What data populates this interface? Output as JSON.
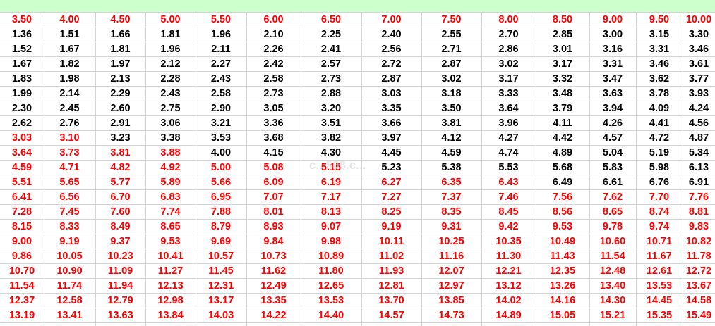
{
  "highlight_color": "#ff0000",
  "normal_color": "#000000",
  "watermark": "c...588.c...",
  "header": [
    "3.50",
    "4.00",
    "4.50",
    "5.00",
    "5.50",
    "6.00",
    "6.50",
    "7.00",
    "7.50",
    "8.00",
    "8.50",
    "9.00",
    "9.50",
    "10.00"
  ],
  "rows": [
    {
      "values": [
        "1.36",
        "1.51",
        "1.66",
        "1.81",
        "1.96",
        "2.10",
        "2.25",
        "2.40",
        "2.55",
        "2.70",
        "2.85",
        "3.00",
        "3.15",
        "3.30"
      ],
      "red": []
    },
    {
      "values": [
        "1.52",
        "1.67",
        "1.81",
        "1.96",
        "2.11",
        "2.26",
        "2.41",
        "2.56",
        "2.71",
        "2.86",
        "3.01",
        "3.16",
        "3.31",
        "3.46"
      ],
      "red": []
    },
    {
      "values": [
        "1.67",
        "1.82",
        "1.97",
        "2.12",
        "2.27",
        "2.42",
        "2.57",
        "2.72",
        "2.87",
        "3.02",
        "3.17",
        "3.31",
        "3.46",
        "3.61"
      ],
      "red": []
    },
    {
      "values": [
        "1.83",
        "1.98",
        "2.13",
        "2.28",
        "2.43",
        "2.58",
        "2.73",
        "2.87",
        "3.02",
        "3.17",
        "3.32",
        "3.47",
        "3.62",
        "3.77"
      ],
      "red": []
    },
    {
      "values": [
        "1.99",
        "2.14",
        "2.29",
        "2.43",
        "2.58",
        "2.73",
        "2.88",
        "3.03",
        "3.18",
        "3.33",
        "3.48",
        "3.63",
        "3.78",
        "3.93"
      ],
      "red": []
    },
    {
      "values": [
        "2.30",
        "2.45",
        "2.60",
        "2.75",
        "2.90",
        "3.05",
        "3.20",
        "3.35",
        "3.50",
        "3.64",
        "3.79",
        "3.94",
        "4.09",
        "4.24"
      ],
      "red": []
    },
    {
      "values": [
        "2.62",
        "2.76",
        "2.91",
        "3.06",
        "3.21",
        "3.36",
        "3.51",
        "3.66",
        "3.81",
        "3.96",
        "4.11",
        "4.26",
        "4.41",
        "4.56"
      ],
      "red": []
    },
    {
      "values": [
        "3.03",
        "3.10",
        "3.23",
        "3.38",
        "3.53",
        "3.68",
        "3.82",
        "3.97",
        "4.12",
        "4.27",
        "4.42",
        "4.57",
        "4.72",
        "4.87"
      ],
      "red": [
        0,
        1
      ]
    },
    {
      "values": [
        "3.64",
        "3.73",
        "3.81",
        "3.88",
        "4.00",
        "4.15",
        "4.30",
        "4.45",
        "4.59",
        "4.74",
        "4.89",
        "5.04",
        "5.19",
        "5.34"
      ],
      "red": [
        0,
        1,
        2,
        3
      ]
    },
    {
      "values": [
        "4.59",
        "4.71",
        "4.82",
        "4.92",
        "5.00",
        "5.08",
        "5.15",
        "5.23",
        "5.38",
        "5.53",
        "5.68",
        "5.83",
        "5.98",
        "6.13"
      ],
      "red": [
        0,
        1,
        2,
        3,
        4,
        5,
        6
      ]
    },
    {
      "values": [
        "5.51",
        "5.65",
        "5.77",
        "5.89",
        "5.66",
        "6.09",
        "6.19",
        "6.27",
        "6.35",
        "6.43",
        "6.49",
        "6.61",
        "6.76",
        "6.91"
      ],
      "red": [
        0,
        1,
        2,
        3,
        4,
        5,
        6,
        7,
        8,
        9
      ]
    },
    {
      "values": [
        "6.41",
        "6.56",
        "6.70",
        "6.83",
        "6.95",
        "7.07",
        "7.17",
        "7.27",
        "7.37",
        "7.46",
        "7.56",
        "7.62",
        "7.70",
        "7.76"
      ],
      "red": [
        0,
        1,
        2,
        3,
        4,
        5,
        6,
        7,
        8,
        9,
        10,
        11,
        12,
        13
      ]
    },
    {
      "values": [
        "7.28",
        "7.45",
        "7.60",
        "7.74",
        "7.88",
        "8.01",
        "8.13",
        "8.25",
        "8.35",
        "8.45",
        "8.56",
        "8.65",
        "8.74",
        "8.81"
      ],
      "red": [
        0,
        1,
        2,
        3,
        4,
        5,
        6,
        7,
        8,
        9,
        10,
        11,
        12,
        13
      ]
    },
    {
      "values": [
        "8.15",
        "8.33",
        "8.49",
        "8.65",
        "8.79",
        "8.93",
        "9.07",
        "9.19",
        "9.31",
        "9.42",
        "9.53",
        "9.78",
        "9.74",
        "9.83"
      ],
      "red": [
        0,
        1,
        2,
        3,
        4,
        5,
        6,
        7,
        8,
        9,
        10,
        11,
        12,
        13
      ]
    },
    {
      "values": [
        "9.00",
        "9.19",
        "9.37",
        "9.53",
        "9.69",
        "9.84",
        "9.98",
        "10.11",
        "10.25",
        "10.35",
        "10.49",
        "10.60",
        "10.71",
        "10.82"
      ],
      "red": [
        0,
        1,
        2,
        3,
        4,
        5,
        6,
        7,
        8,
        9,
        10,
        11,
        12,
        13
      ]
    },
    {
      "values": [
        "9.86",
        "10.05",
        "10.23",
        "10.41",
        "10.57",
        "10.73",
        "10.89",
        "11.02",
        "11.16",
        "11.30",
        "11.43",
        "11.54",
        "11.67",
        "11.78"
      ],
      "red": [
        0,
        1,
        2,
        3,
        4,
        5,
        6,
        7,
        8,
        9,
        10,
        11,
        12,
        13
      ]
    },
    {
      "values": [
        "10.70",
        "10.90",
        "11.09",
        "11.27",
        "11.45",
        "11.62",
        "11.80",
        "11.93",
        "12.07",
        "12.21",
        "12.35",
        "12.48",
        "12.61",
        "12.72"
      ],
      "red": [
        0,
        1,
        2,
        3,
        4,
        5,
        6,
        7,
        8,
        9,
        10,
        11,
        12,
        13
      ]
    },
    {
      "values": [
        "11.54",
        "11.74",
        "11.94",
        "12.13",
        "12.31",
        "12.49",
        "12.65",
        "12.81",
        "12.97",
        "13.12",
        "13.26",
        "13.40",
        "13.53",
        "13.67"
      ],
      "red": [
        0,
        1,
        2,
        3,
        4,
        5,
        6,
        7,
        8,
        9,
        10,
        11,
        12,
        13
      ]
    },
    {
      "values": [
        "12.37",
        "12.58",
        "12.79",
        "12.98",
        "13.17",
        "13.35",
        "13.53",
        "13.70",
        "13.85",
        "14.02",
        "14.16",
        "14.30",
        "14.45",
        "14.58"
      ],
      "red": [
        0,
        1,
        2,
        3,
        4,
        5,
        6,
        7,
        8,
        9,
        10,
        11,
        12,
        13
      ]
    },
    {
      "values": [
        "13.19",
        "13.41",
        "13.63",
        "13.84",
        "14.03",
        "14.22",
        "14.40",
        "14.57",
        "14.73",
        "14.89",
        "15.05",
        "15.21",
        "15.35",
        "15.49"
      ],
      "red": [
        0,
        1,
        2,
        3,
        4,
        5,
        6,
        7,
        8,
        9,
        10,
        11,
        12,
        13
      ]
    }
  ]
}
